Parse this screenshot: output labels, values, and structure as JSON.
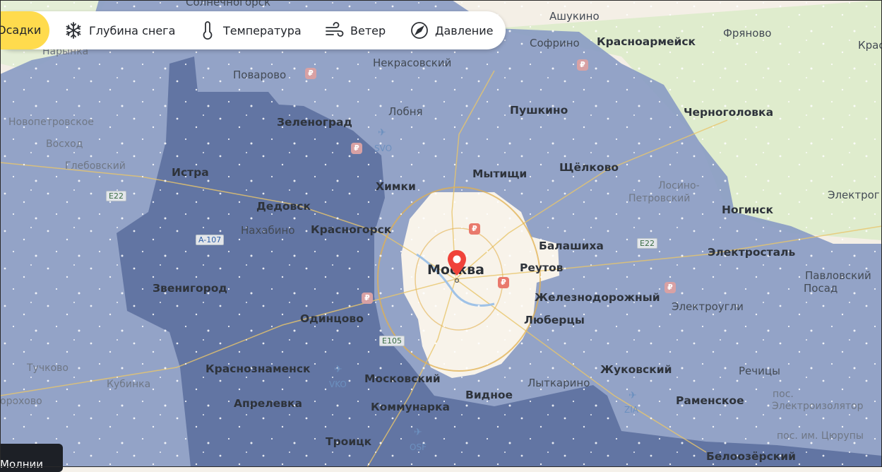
{
  "toolbar": {
    "active_label": "Осадки",
    "items": [
      {
        "label": "Глубина снега",
        "icon": "snowflake-icon"
      },
      {
        "label": "Температура",
        "icon": "thermometer-icon"
      },
      {
        "label": "Ветер",
        "icon": "wind-icon"
      },
      {
        "label": "Давление",
        "icon": "pressure-icon"
      }
    ]
  },
  "marker": {
    "icon": "location-pin-icon",
    "color": "#f0433a"
  },
  "layers_badge": {
    "label": "Молнии"
  },
  "map_labels": {
    "solnechnogorsk": "Солнечногорск",
    "narynka": "Нарынка",
    "povarovo": "Поварово",
    "nekrasovsky": "Некрасовский",
    "ashukino": "Ашукино",
    "sofrino": "Софрино",
    "krasnoarmeysk": "Красноармейск",
    "fryanovo": "Фряново",
    "kras": "Крас",
    "novopetrovskoe": "Новопетровское",
    "zelenograd": "Зеленоград",
    "lobnya": "Лобня",
    "pushkino": "Пушкино",
    "chernogolovka": "Черноголовка",
    "voskhod": "Восход",
    "glebovsky": "Глебовский",
    "istra": "Истра",
    "svo": "SVO",
    "khimki": "Химки",
    "mytishchi": "Мытищи",
    "shchyolkovo": "Щёлково",
    "losino1": "Лосино-",
    "losino2": "Петровский",
    "elektrogorsk": "Электрог",
    "dedovsk": "Дедовск",
    "noginsk": "Ногинск",
    "nakhabino": "Нахабино",
    "krasnogorsk": "Красногорск",
    "balashikha": "Балашиха",
    "elektrostal": "Электросталь",
    "moskva": "Москва",
    "reutov": "Реутов",
    "pavlovsky1": "Павловский",
    "pavlovsky2": "Посад",
    "zvenigorod": "Звенигород",
    "zheleznodorozhny": "Железнодорожный",
    "elektrougli": "Электроугли",
    "odintsovo": "Одинцово",
    "lyubertsy": "Люберцы",
    "tuchkovo": "Тучково",
    "krasnoznamensk": "Краснознаменск",
    "zhukovsky": "Жуковский",
    "rechitsy": "Речицы",
    "vko": "VKO",
    "kubinka": "Кубинка",
    "moskovsky": "Московский",
    "lytkarino": "Лыткарино",
    "vidnoe": "Видное",
    "ramenskoe": "Раменское",
    "pos1": "пос.",
    "pos2": "Электроизолятор",
    "dorokhovo": "орохово",
    "aprelevka": "Апрелевка",
    "kommunarka": "Коммунарка",
    "zia": "ZIA",
    "pos_tsyurupy": "пос. им. Цюрупы",
    "troitsk": "Троицк",
    "osf": "OSF",
    "beloozersky": "Белоозёрский"
  },
  "highways": [
    "E22",
    "A-107",
    "E22",
    "E105"
  ],
  "colors": {
    "toolbar_active": "#ffdb4d",
    "precip_light": "#8497c0",
    "precip_heavy": "#5c6f9e",
    "forest": "#dfeccd"
  }
}
